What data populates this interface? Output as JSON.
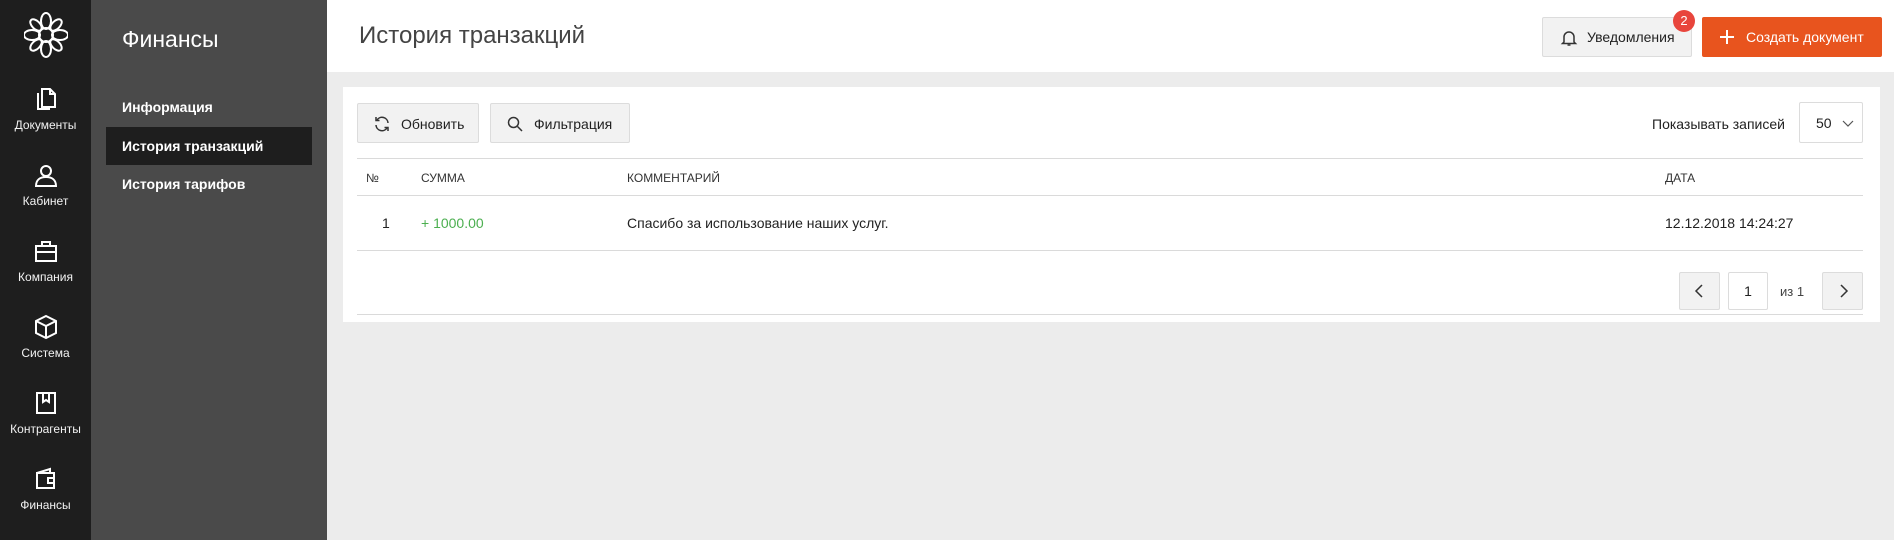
{
  "rail": {
    "items": [
      {
        "label": "Документы",
        "icon": "documents-icon"
      },
      {
        "label": "Кабинет",
        "icon": "user-icon"
      },
      {
        "label": "Компания",
        "icon": "briefcase-icon"
      },
      {
        "label": "Система",
        "icon": "cube-icon"
      },
      {
        "label": "Контрагенты",
        "icon": "bookmark-book-icon"
      },
      {
        "label": "Финансы",
        "icon": "wallet-icon"
      }
    ]
  },
  "subnav": {
    "title": "Финансы",
    "items": [
      {
        "label": "Информация",
        "active": false
      },
      {
        "label": "История транзакций",
        "active": true
      },
      {
        "label": "История тарифов",
        "active": false
      }
    ]
  },
  "header": {
    "title": "История транзакций",
    "notifications_label": "Уведомления",
    "notifications_count": "2",
    "create_label": "Создать документ"
  },
  "toolbar": {
    "refresh_label": "Обновить",
    "filter_label": "Фильтрация",
    "per_page_label": "Показывать записей",
    "per_page_value": "50"
  },
  "table": {
    "columns": [
      "№",
      "Сумма",
      "Комментарий",
      "Дата"
    ],
    "rows": [
      {
        "num": "1",
        "amount": "+ 1000.00",
        "comment": "Спасибо за использование наших услуг.",
        "date": "12.12.2018 14:24:27"
      }
    ]
  },
  "pager": {
    "current": "1",
    "of_label": "из 1"
  },
  "colors": {
    "accent": "#e8541e",
    "badge": "#e8453c",
    "positive": "#4caf50",
    "rail_bg": "#1e1e1e",
    "subnav_bg": "#4a4a4a"
  }
}
